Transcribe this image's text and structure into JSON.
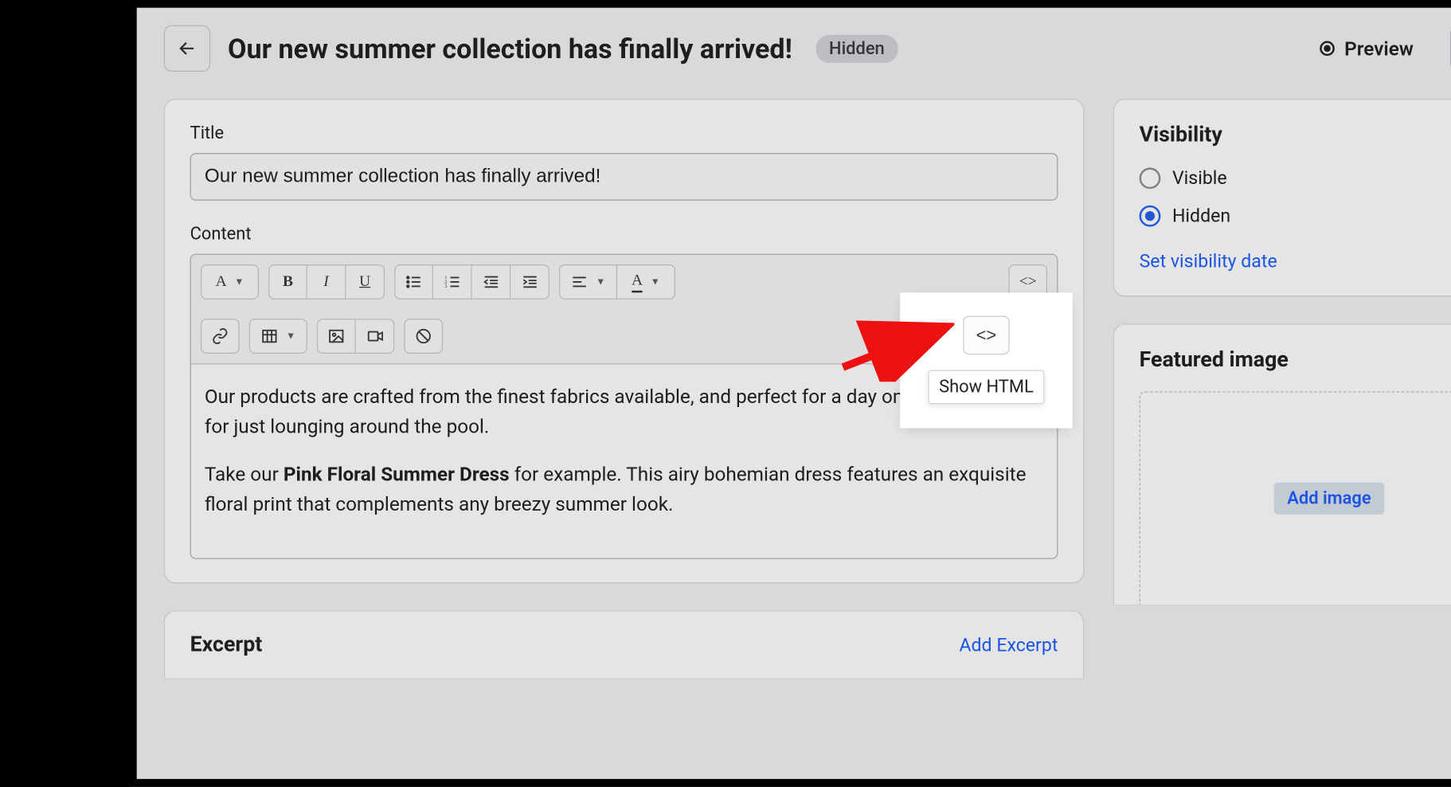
{
  "header": {
    "page_title": "Our new summer collection has finally arrived!",
    "status_badge": "Hidden",
    "preview_label": "Preview"
  },
  "main": {
    "title_label": "Title",
    "title_value": "Our new summer collection has finally arrived!",
    "content_label": "Content",
    "toolbar": {
      "paragraph_format": "A",
      "font_color": "A"
    },
    "content_paragraph1": "Our products are crafted from the finest fabrics available, and perfect for a day on the beach or for just lounging around the pool.",
    "content_paragraph2_pre": "Take our ",
    "content_paragraph2_bold": "Pink Floral Summer Dress",
    "content_paragraph2_post": " for example. This airy bohemian dress features an exquisite floral print that complements any breezy summer look.",
    "excerpt_title": "Excerpt",
    "add_excerpt": "Add Excerpt"
  },
  "sidebar": {
    "visibility": {
      "title": "Visibility",
      "visible_label": "Visible",
      "hidden_label": "Hidden",
      "selected": "hidden",
      "set_date_label": "Set visibility date"
    },
    "featured_image": {
      "title": "Featured image",
      "add_label": "Add image"
    }
  },
  "highlight": {
    "tooltip": "Show HTML",
    "code_glyph": "<>"
  }
}
